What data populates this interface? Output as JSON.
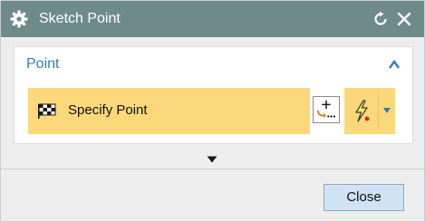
{
  "dialog": {
    "title": "Sketch Point",
    "icons": {
      "app": "gear-icon",
      "reset": "reset-icon",
      "close": "close-icon"
    }
  },
  "point_group": {
    "header": "Point",
    "specify_label": "Specify Point",
    "icons": {
      "collapse": "chevron-up-icon",
      "flag": "checkered-flag-icon",
      "inferred_point": "inferred-point-icon",
      "snap_point": "lightning-bolt-icon",
      "snap_dropdown": "caret-down-icon"
    }
  },
  "more_options": {
    "icon": "expand-triangle-icon"
  },
  "footer": {
    "close_label": "Close"
  },
  "colors": {
    "titlebar": "#6f8b89",
    "accent_text": "#2e7fb8",
    "selection": "#fbd87a",
    "button": "#cfe3f4"
  }
}
